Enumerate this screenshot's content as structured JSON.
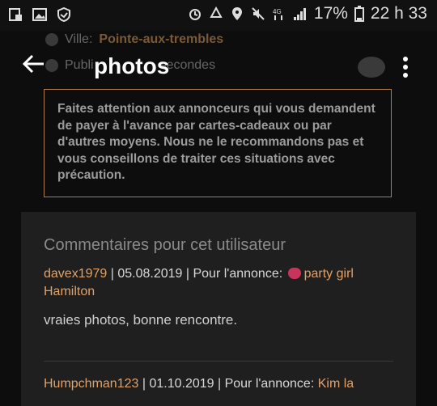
{
  "status_bar": {
    "battery_percent": "17%",
    "time": "22 h 33",
    "icons": [
      "screenshot-icon",
      "image-icon",
      "shield-icon",
      "alarm-icon",
      "recycle-icon",
      "location-icon",
      "mute-icon",
      "data-4g-icon",
      "signal-icon",
      "battery-icon"
    ]
  },
  "background_meta": {
    "city_label": "Ville:",
    "city_value": "Pointe-aux-trembles",
    "published_prefix": "Publi",
    "published_suffix": "secondes"
  },
  "app_bar": {
    "title": "photos"
  },
  "warning": {
    "text": "Faites attention aux annonceurs qui vous demandent de payer à l'avance par cartes-cadeaux ou par d'autres moyens. Nous ne le recommandons pas et vous conseillons de traiter ces situations avec précaution."
  },
  "comments": {
    "heading": "Commentaires pour cet utilisateur",
    "items": [
      {
        "author": "davex1979",
        "date": "05.08.2019",
        "ad_prefix": "Pour l'annonce:",
        "ad_title_1": "party girl",
        "ad_title_2": "Hamilton",
        "text": "vraies photos, bonne rencontre."
      },
      {
        "author": "Humpchman123",
        "date": "01.10.2019",
        "ad_prefix": "Pour l'annonce:",
        "ad_title_1": "Kim la"
      }
    ]
  },
  "colors": {
    "accent": "#e0a26a",
    "warning_border": "#b07a4a",
    "panel": "#1f1f1f",
    "background": "#0d0d0d"
  }
}
